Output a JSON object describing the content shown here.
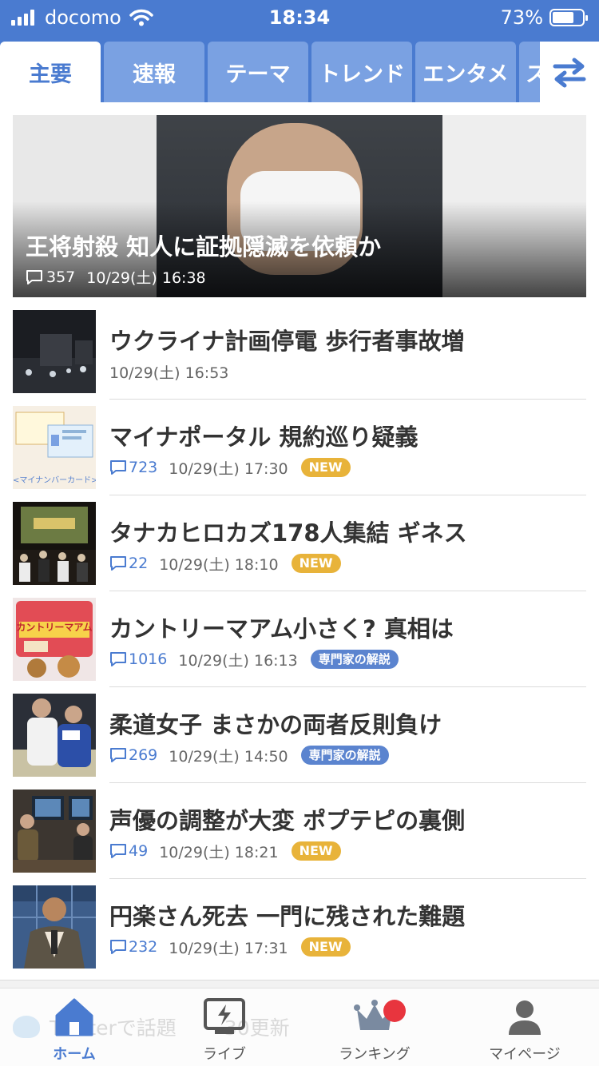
{
  "status_bar": {
    "carrier": "docomo",
    "time": "18:34",
    "battery_percent": "73%",
    "battery_level": 0.73
  },
  "tabs": [
    {
      "label": "主要",
      "active": true
    },
    {
      "label": "速報",
      "active": false
    },
    {
      "label": "テーマ",
      "active": false
    },
    {
      "label": "トレンド",
      "active": false
    },
    {
      "label": "エンタメ",
      "active": false
    },
    {
      "label": "ス",
      "active": false
    }
  ],
  "top_story": {
    "title": "王将射殺 知人に証拠隠滅を依頼か",
    "comments": "357",
    "time": "10/29(土) 16:38"
  },
  "news": [
    {
      "title": "ウクライナ計画停電 歩行者事故増",
      "comments": "",
      "time": "10/29(土) 16:53",
      "badge": ""
    },
    {
      "title": "マイナポータル 規約巡り疑義",
      "comments": "723",
      "time": "10/29(土) 17:30",
      "badge": "NEW",
      "thumb_text": "<マイナンバーカード>"
    },
    {
      "title": "タナカヒロカズ178人集結 ギネス",
      "comments": "22",
      "time": "10/29(土) 18:10",
      "badge": "NEW"
    },
    {
      "title": "カントリーマアム小さく? 真相は",
      "comments": "1016",
      "time": "10/29(土) 16:13",
      "badge": "専門家の解説",
      "thumb_text": "カントリーマアム"
    },
    {
      "title": "柔道女子 まさかの両者反則負け",
      "comments": "269",
      "time": "10/29(土) 14:50",
      "badge": "専門家の解説"
    },
    {
      "title": "声優の調整が大変 ポプテピの裏側",
      "comments": "49",
      "time": "10/29(土) 18:21",
      "badge": "NEW"
    },
    {
      "title": "円楽さん死去 一門に残された難題",
      "comments": "232",
      "time": "10/29(土) 17:31",
      "badge": "NEW"
    }
  ],
  "background_peek": {
    "text": "Twitterで話題",
    "update": "30更新"
  },
  "bottom_nav": [
    {
      "label": "ホーム",
      "icon": "home-icon",
      "active": true
    },
    {
      "label": "ライブ",
      "icon": "live-tv-icon",
      "active": false
    },
    {
      "label": "ランキング",
      "icon": "crown-icon",
      "active": false
    },
    {
      "label": "マイページ",
      "icon": "person-icon",
      "active": false
    }
  ],
  "colors": {
    "brand": "#4a7bd0",
    "new_badge": "#e8b33a",
    "expert_badge": "#5b84cf",
    "notification": "#e8353e"
  }
}
